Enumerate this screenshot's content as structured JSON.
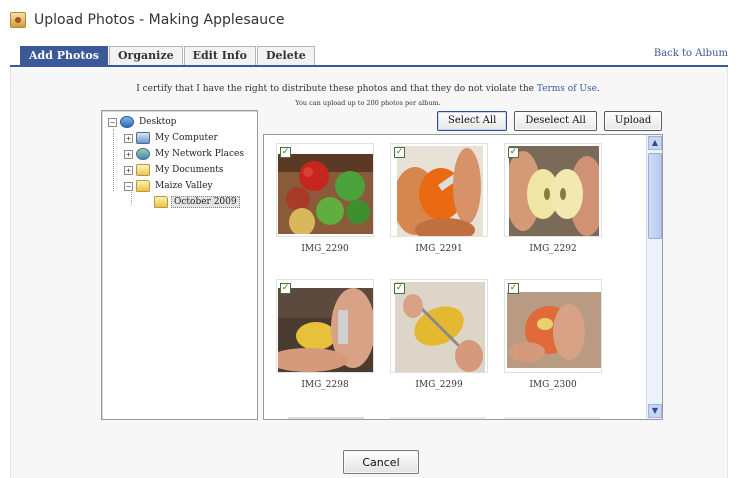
{
  "header": {
    "title": "Upload Photos - Making Applesauce",
    "icon": "photo-upload-icon"
  },
  "tabs": [
    {
      "label": "Add Photos",
      "active": true
    },
    {
      "label": "Organize",
      "active": false
    },
    {
      "label": "Edit Info",
      "active": false
    },
    {
      "label": "Delete",
      "active": false
    }
  ],
  "back_link": "Back to Album",
  "certify": {
    "text_before": "I certify that I have the right to distribute these photos and that they do not violate the",
    "terms_link": "Terms of Use",
    "text_after": ".",
    "limit": "You can upload up to 200 photos per album."
  },
  "tree": {
    "items": [
      {
        "label": "Desktop",
        "icon": "desktop-icon",
        "toggle": "−"
      },
      {
        "label": "My Computer",
        "icon": "computer-icon",
        "toggle": "+"
      },
      {
        "label": "My Network Places",
        "icon": "network-icon",
        "toggle": "+"
      },
      {
        "label": "My Documents",
        "icon": "documents-icon",
        "toggle": "+"
      },
      {
        "label": "Maize Valley",
        "icon": "folder-icon",
        "toggle": "−"
      },
      {
        "label": "October 2009",
        "icon": "folder-open-icon",
        "selected": true
      }
    ]
  },
  "actions": {
    "select_all": "Select All",
    "deselect_all": "Deselect All",
    "upload": "Upload",
    "cancel": "Cancel"
  },
  "photos": [
    {
      "name": "IMG_2290",
      "checked": true
    },
    {
      "name": "IMG_2291",
      "checked": true
    },
    {
      "name": "IMG_2292",
      "checked": true
    },
    {
      "name": "IMG_2298",
      "checked": true
    },
    {
      "name": "IMG_2299",
      "checked": true
    },
    {
      "name": "IMG_2300",
      "checked": true
    }
  ],
  "colors": {
    "accent": "#3b5998",
    "panel": "#f7f7f7",
    "check": "#2f7d1f"
  }
}
